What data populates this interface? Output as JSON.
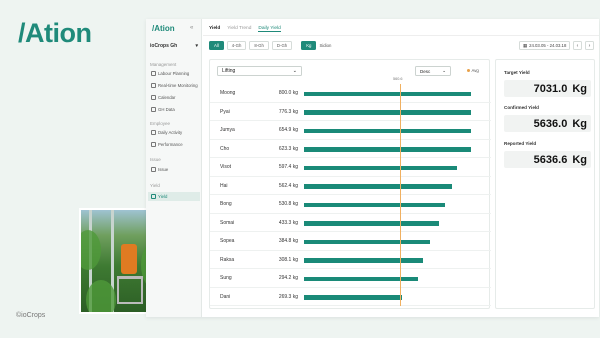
{
  "brand": {
    "logo": "/Ation",
    "watermark": "©ioCrops"
  },
  "sidebar": {
    "logo": "/Ation",
    "org": "ioCrops Gh",
    "sections": [
      {
        "title": "Management",
        "items": [
          {
            "label": "Labour Planning",
            "icon": "calendar-icon"
          },
          {
            "label": "Real-time Monitoring",
            "icon": "monitor-icon"
          },
          {
            "label": "Calendar",
            "icon": "calendar-icon"
          },
          {
            "label": "GH Data",
            "icon": "data-icon"
          }
        ]
      },
      {
        "title": "Employee",
        "items": [
          {
            "label": "Daily Activity",
            "icon": "activity-icon"
          },
          {
            "label": "Performance",
            "icon": "chart-icon"
          }
        ]
      },
      {
        "title": "Issue",
        "items": [
          {
            "label": "Issue",
            "icon": "issue-icon"
          }
        ]
      },
      {
        "title": "Yield",
        "items": [
          {
            "label": "Yield",
            "icon": "yield-icon",
            "active": true
          }
        ]
      }
    ]
  },
  "tabs": [
    "Yield",
    "Yield Trend",
    "Daily Yield"
  ],
  "toolbar": {
    "filters": [
      "All",
      "4-Gh",
      "8-Gh",
      "D-Gh"
    ],
    "unit": "Kg",
    "unit_alt": "Sidion",
    "date_range": "24.03.05 - 24.03.18"
  },
  "chart": {
    "select_value": "Lifting",
    "sort_label": "Desc",
    "legend_avg": "Avg",
    "avg_label": "560.6"
  },
  "chart_data": {
    "type": "bar",
    "orientation": "horizontal",
    "categories": [
      "Moong",
      "Pyai",
      "Jumya",
      "Cho",
      "Visot",
      "Hai",
      "Bong",
      "Somai",
      "Sopea",
      "Raksa",
      "Sung",
      "Dani"
    ],
    "value_labels": [
      "800.0 kg",
      "776.3 kg",
      "654.9 kg",
      "623.3 kg",
      "597.4 kg",
      "562.4 kg",
      "530.8 kg",
      "433.3 kg",
      "384.8 kg",
      "308.1 kg",
      "294.2 kg",
      "269.3 kg"
    ],
    "bar_fraction": [
      0.94,
      0.94,
      0.94,
      0.94,
      0.86,
      0.83,
      0.79,
      0.76,
      0.71,
      0.67,
      0.64,
      0.55
    ],
    "avg": 560.6,
    "avg_fraction": 0.54
  },
  "stats": {
    "target_label": "Target Yield",
    "target_value": "7031.0",
    "target_unit": "Kg",
    "confirmed_label": "Confirmed Yield",
    "confirmed_value": "5636.0",
    "confirmed_unit": "Kg",
    "reported_label": "Reported Yield",
    "reported_value": "5636.6",
    "reported_unit": "Kg"
  },
  "colors": {
    "brand": "#1f8a7a",
    "bar": "#1a8a78",
    "avg_line": "#f0b060"
  }
}
